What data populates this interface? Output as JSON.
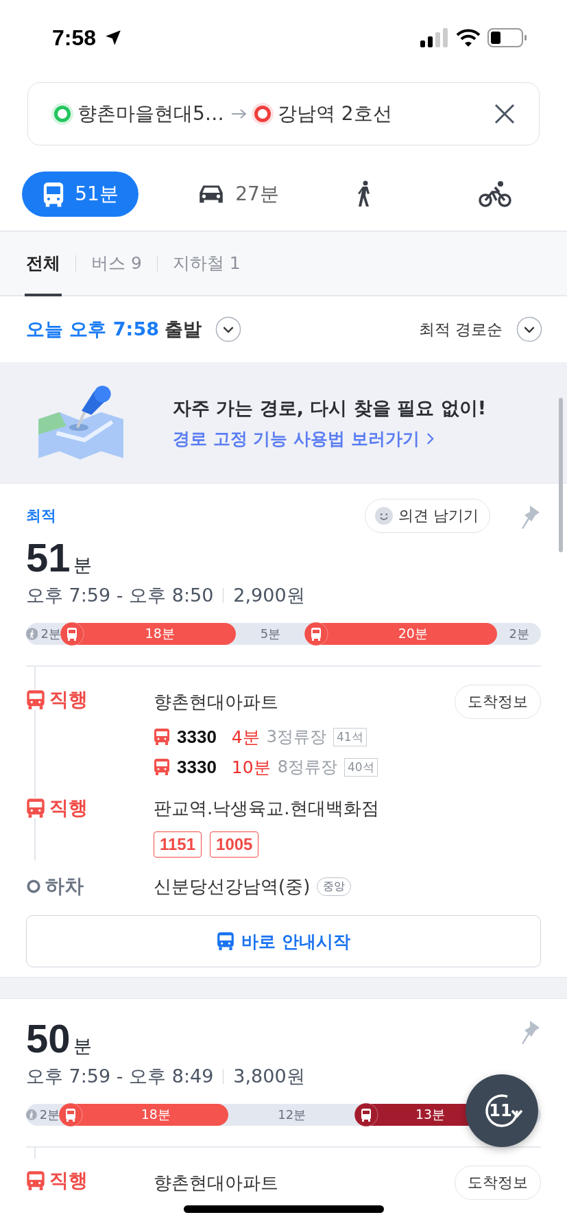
{
  "status_bar": {
    "time": "7:58"
  },
  "route": {
    "origin": "향촌마을현대5…",
    "destination": "강남역 2호선"
  },
  "modes": [
    {
      "kind": "transit",
      "label": "51분",
      "selected": true
    },
    {
      "kind": "car",
      "label": "27분",
      "selected": false
    },
    {
      "kind": "walk",
      "selected": false
    },
    {
      "kind": "bike",
      "selected": false
    }
  ],
  "filter_tabs": [
    {
      "label": "전체",
      "selected": true
    },
    {
      "label": "버스 9",
      "selected": false
    },
    {
      "label": "지하철 1",
      "selected": false
    }
  ],
  "departure": {
    "time": "오늘 오후 7:58",
    "suffix": "출발"
  },
  "sort": "최적 경로순",
  "banner": {
    "title": "자주 가는 경로, 다시 찾을 필요 없이!",
    "link": "경로 고정 기능 사용법 보러가기"
  },
  "routes": [
    {
      "tag": "최적",
      "feedback": "의견 남기기",
      "duration": "51",
      "unit": "분",
      "times": "오후 7:59 - 오후 8:50",
      "fare": "2,900원",
      "segments": [
        {
          "kind": "walk",
          "label": "2분"
        },
        {
          "kind": "bus",
          "label": "18분"
        },
        {
          "kind": "gap",
          "label": "5분"
        },
        {
          "kind": "bus",
          "label": "20분"
        },
        {
          "kind": "gap",
          "label": "2분"
        }
      ],
      "steps": [
        {
          "kind": "bus",
          "label": "직행",
          "stop": "향촌현대아파트",
          "button": "도착정보",
          "arrivals": [
            {
              "number": "3330",
              "eta": "4분",
              "stops": "3정류장",
              "seats": "41석"
            },
            {
              "number": "3330",
              "eta": "10분",
              "stops": "8정류장",
              "seats": "40석"
            }
          ]
        },
        {
          "kind": "bus",
          "label": "직행",
          "stop": "판교역.낙생육교.현대백화점",
          "lines": [
            "1151",
            "1005"
          ]
        },
        {
          "kind": "alight",
          "label": "하차",
          "stop": "신분당선강남역(중)",
          "badge": "중앙"
        }
      ],
      "start_button": "바로 안내시작"
    },
    {
      "duration": "50",
      "unit": "분",
      "times": "오후 7:59 - 오후 8:49",
      "fare": "3,800원",
      "segments": [
        {
          "kind": "walk",
          "label": "2분"
        },
        {
          "kind": "bus",
          "label": "18분"
        },
        {
          "kind": "gap",
          "label": "12분"
        },
        {
          "kind": "subway",
          "label": "13분"
        }
      ],
      "steps": [
        {
          "kind": "bus",
          "label": "직행",
          "stop": "향촌현대아파트",
          "button": "도착정보"
        }
      ]
    }
  ],
  "fab": {
    "label": "11"
  }
}
